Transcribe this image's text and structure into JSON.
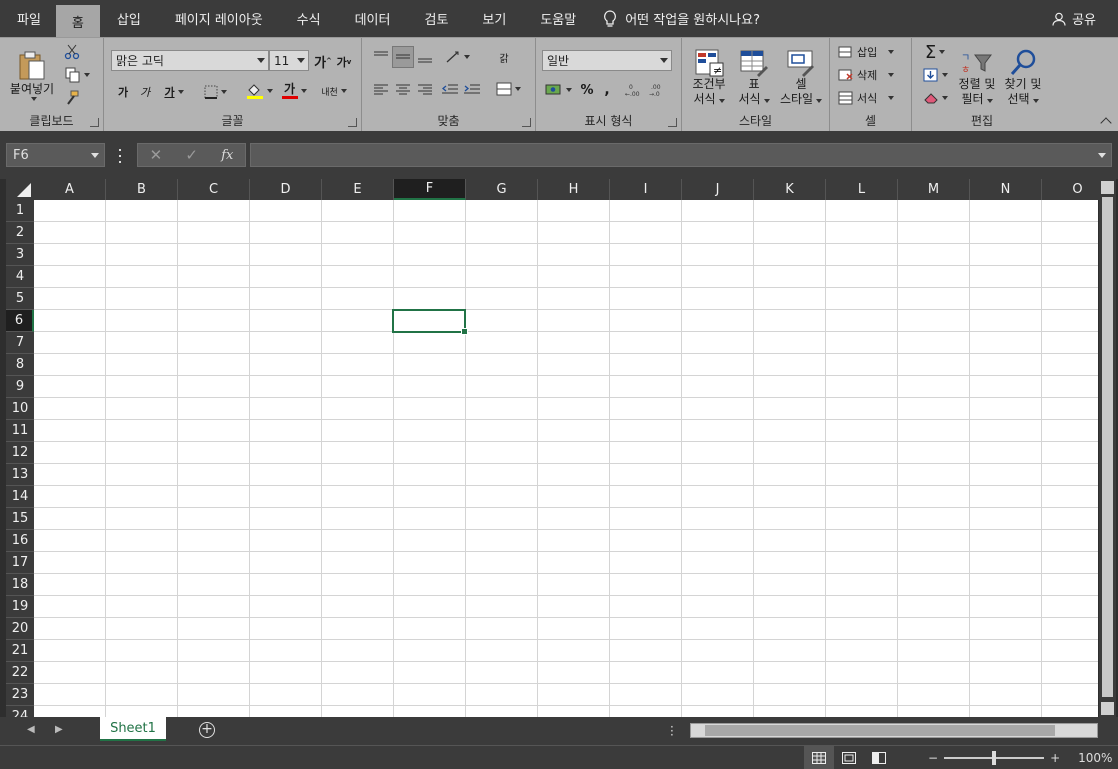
{
  "menu": {
    "tabs": [
      "파일",
      "홈",
      "삽입",
      "페이지 레이아웃",
      "수식",
      "데이터",
      "검토",
      "보기",
      "도움말"
    ],
    "active_tab": "홈",
    "tell_me": "어떤 작업을 원하시나요?",
    "share": "공유"
  },
  "ribbon": {
    "clipboard": {
      "label": "클립보드",
      "paste": "붙여넣기"
    },
    "font": {
      "label": "글꼴",
      "font_name": "맑은 고딕",
      "font_size": "11",
      "bold": "가",
      "italic": "가",
      "underline": "가",
      "phonetic": "내천",
      "grow": "가",
      "shrink": "가",
      "font_color_glyph": "가"
    },
    "alignment": {
      "label": "맞춤",
      "wrap": "갉"
    },
    "number": {
      "label": "표시 형식",
      "format": "일반",
      "percent": "%",
      "comma": ","
    },
    "styles": {
      "label": "스타일",
      "conditional": [
        "조건부",
        "서식"
      ],
      "table": [
        "표",
        "서식"
      ],
      "cell": [
        "셀",
        "스타일"
      ]
    },
    "cells": {
      "label": "셀",
      "insert": "삽입",
      "delete": "삭제",
      "format": "서식"
    },
    "editing": {
      "label": "편집",
      "sort": [
        "정렬 및",
        "필터"
      ],
      "find": [
        "찾기 및",
        "선택"
      ],
      "sum": "Σ"
    }
  },
  "formula_bar": {
    "name_box": "F6",
    "formula": "",
    "fx": "fx"
  },
  "grid": {
    "columns": [
      "A",
      "B",
      "C",
      "D",
      "E",
      "F",
      "G",
      "H",
      "I",
      "J",
      "K",
      "L",
      "M",
      "N",
      "O"
    ],
    "rows": [
      "1",
      "2",
      "3",
      "4",
      "5",
      "6",
      "7",
      "8",
      "9",
      "10",
      "11",
      "12",
      "13",
      "14",
      "15",
      "16",
      "17",
      "18",
      "19",
      "20",
      "21",
      "22",
      "23",
      "24"
    ],
    "selected_column": "F",
    "selected_row": "6"
  },
  "sheets": {
    "tabs": [
      "Sheet1"
    ],
    "active": "Sheet1"
  },
  "status": {
    "zoom": "100%",
    "zoom_level": 1.0
  },
  "colors": {
    "accent": "#217346",
    "ribbon_bg": "#b3b3b3",
    "dark_bg": "#3b3b3b"
  }
}
